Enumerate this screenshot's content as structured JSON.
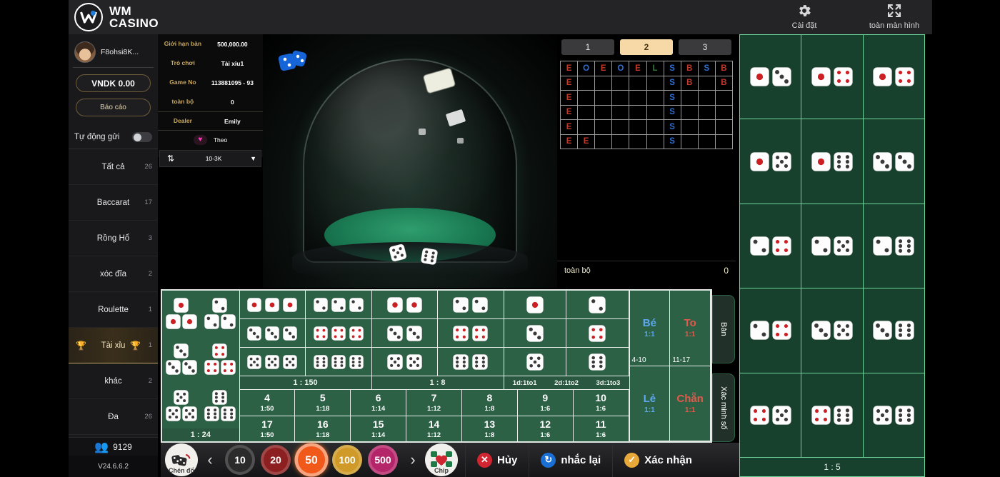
{
  "header": {
    "brand_line1": "WM",
    "brand_line2": "CASINO",
    "settings_label": "Cài đặt",
    "fullscreen_label": "toàn màn hình"
  },
  "sidebar": {
    "username": "F8ohsi8K...",
    "balance": "VNDK 0.00",
    "report_label": "Báo cáo",
    "auto_send_label": "Tự động gửi",
    "items": [
      {
        "label": "Tất cả",
        "count": "26",
        "active": false
      },
      {
        "label": "Baccarat",
        "count": "17",
        "active": false
      },
      {
        "label": "Rồng Hổ",
        "count": "3",
        "active": false
      },
      {
        "label": "xóc đĩa",
        "count": "2",
        "active": false
      },
      {
        "label": "Roulette",
        "count": "1",
        "active": false
      },
      {
        "label": "Tài xỉu",
        "count": "1",
        "active": true
      },
      {
        "label": "khác",
        "count": "2",
        "active": false
      },
      {
        "label": "Đa",
        "count": "26",
        "active": false
      }
    ],
    "online_count": "9129",
    "version": "V24.6.6.2"
  },
  "info": {
    "rows": [
      {
        "key": "Giới hạn bàn",
        "value": "500,000.00"
      },
      {
        "key": "Trò chơi",
        "value": "Tài xỉu1"
      },
      {
        "key": "Game No",
        "value": "113881095 - 93"
      },
      {
        "key": "toàn bộ",
        "value": "0"
      },
      {
        "key": "Dealer",
        "value": "Emily"
      }
    ],
    "theo_label": "Theo",
    "limit_value": "10-3K"
  },
  "roadmap": {
    "tabs": [
      {
        "label": "1",
        "active": false
      },
      {
        "label": "2",
        "active": true
      },
      {
        "label": "3",
        "active": false
      }
    ],
    "columns": 10,
    "rows": 6,
    "cells": [
      [
        "E",
        "O",
        "E",
        "O",
        "E",
        "L",
        "S",
        "B",
        "S",
        "B"
      ],
      [
        "E",
        "",
        "",
        "",
        "",
        "",
        "S",
        "B",
        "",
        "B"
      ],
      [
        "E",
        "",
        "",
        "",
        "",
        "",
        "S",
        "",
        "",
        ""
      ],
      [
        "E",
        "",
        "",
        "",
        "",
        "",
        "S",
        "",
        "",
        ""
      ],
      [
        "E",
        "",
        "",
        "",
        "",
        "",
        "S",
        "",
        "",
        ""
      ],
      [
        "E",
        "E",
        "",
        "",
        "",
        "",
        "S",
        "",
        "",
        ""
      ]
    ],
    "colors": {
      "E": "#c0392b",
      "O": "#2e6fd6",
      "L": "#2e7d32",
      "S": "#2e6fd6",
      "B": "#c0392b"
    },
    "total_label": "toàn bộ",
    "total_value": "0"
  },
  "bet_table": {
    "triples": {
      "odds": "1 : 24",
      "items": [
        [
          1,
          1,
          1
        ],
        [
          2,
          2,
          2
        ],
        [
          3,
          3,
          3
        ],
        [
          4,
          4,
          4
        ],
        [
          5,
          5,
          5
        ],
        [
          6,
          6,
          6
        ]
      ]
    },
    "groups": [
      {
        "odds": "1 : 150",
        "cells": [
          [
            1,
            1,
            1
          ],
          [
            2,
            2,
            2
          ],
          [
            3,
            3,
            3
          ],
          [
            4,
            4,
            4
          ],
          [
            5,
            5,
            5
          ],
          [
            6,
            6,
            6
          ]
        ],
        "columns": 2
      },
      {
        "odds": "1 : 8",
        "cells": [
          [
            1,
            1
          ],
          [
            2,
            2
          ],
          [
            3,
            3
          ],
          [
            4,
            4
          ],
          [
            5,
            5
          ],
          [
            6,
            6
          ]
        ],
        "columns": 2
      },
      {
        "odds_multi": [
          "1d:1to1",
          "2d:1to2",
          "3d:1to3"
        ],
        "cells": [
          [
            1
          ],
          [
            2
          ],
          [
            3
          ],
          [
            4
          ],
          [
            5
          ],
          [
            6
          ]
        ],
        "columns": 2
      }
    ],
    "numbers_row1": [
      {
        "n": "4",
        "o": "1:50"
      },
      {
        "n": "5",
        "o": "1:18"
      },
      {
        "n": "6",
        "o": "1:14"
      },
      {
        "n": "7",
        "o": "1:12"
      },
      {
        "n": "8",
        "o": "1:8"
      },
      {
        "n": "9",
        "o": "1:6"
      },
      {
        "n": "10",
        "o": "1:6"
      }
    ],
    "numbers_row2": [
      {
        "n": "17",
        "o": "1:50"
      },
      {
        "n": "16",
        "o": "1:18"
      },
      {
        "n": "15",
        "o": "1:14"
      },
      {
        "n": "14",
        "o": "1:12"
      },
      {
        "n": "13",
        "o": "1:8"
      },
      {
        "n": "12",
        "o": "1:6"
      },
      {
        "n": "11",
        "o": "1:6"
      }
    ],
    "big_small": [
      {
        "title": "Bé",
        "payout": "1:1",
        "range": "4-10",
        "style": "blue"
      },
      {
        "title": "To",
        "payout": "1:1",
        "range": "11-17",
        "style": "red"
      },
      {
        "title": "Lẻ",
        "payout": "1:1",
        "range": "",
        "style": "blue"
      },
      {
        "title": "Chẵn",
        "payout": "1:1",
        "range": "",
        "style": "red"
      }
    ],
    "side_tabs": [
      "Bàn",
      "Xác minh số"
    ]
  },
  "results_grid": {
    "rows": [
      [
        [
          1,
          3
        ],
        [
          1,
          4
        ],
        [
          1,
          4
        ]
      ],
      [
        [
          1,
          5
        ],
        [
          1,
          6
        ],
        [
          3,
          3
        ]
      ],
      [
        [
          2,
          4
        ],
        [
          2,
          5
        ],
        [
          2,
          6
        ]
      ],
      [
        [
          2,
          4
        ],
        [
          3,
          5
        ],
        [
          3,
          6
        ]
      ],
      [
        [
          4,
          5
        ],
        [
          4,
          6
        ],
        [
          5,
          6
        ]
      ]
    ],
    "footer_odds": "1 : 5"
  },
  "bottom_bar": {
    "cancel_label": "Hủy",
    "repeat_label": "nhắc lại",
    "confirm_label": "Xác nhận",
    "left_button_label": "Chén đổ",
    "right_button_label": "Chip",
    "chips": [
      {
        "value": "10",
        "color": "#2b2b2b",
        "selected": false
      },
      {
        "value": "20",
        "color": "#8c2020",
        "selected": false
      },
      {
        "value": "50",
        "color": "#f1591b",
        "selected": true
      },
      {
        "value": "100",
        "color": "#cf9a27",
        "selected": false
      },
      {
        "value": "500",
        "color": "#b52569",
        "selected": false
      }
    ],
    "prev_arrow": "‹",
    "next_arrow": "›"
  }
}
